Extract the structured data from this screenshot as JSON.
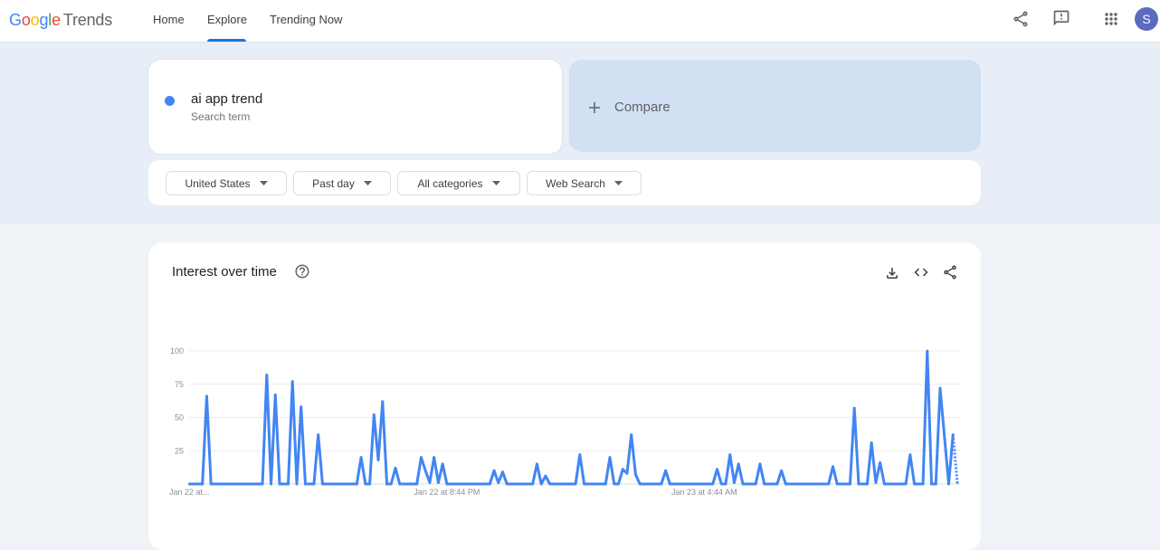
{
  "app": {
    "logo_word": "Google",
    "logo_colors": [
      "#4285f4",
      "#ea4335",
      "#fbbc05",
      "#4285f4",
      "#34a853",
      "#ea4335"
    ],
    "product_name": "Trends"
  },
  "nav": {
    "items": [
      {
        "label": "Home",
        "active": false
      },
      {
        "label": "Explore",
        "active": true
      },
      {
        "label": "Trending Now",
        "active": false
      }
    ],
    "accent_color": "#1a73e8"
  },
  "header_actions": {
    "icons": [
      "share-icon",
      "feedback-icon",
      "apps-grid-icon"
    ],
    "avatar": {
      "initial": "S",
      "color": "#5c6bc0"
    }
  },
  "search": {
    "term": "ai app trend",
    "sublabel": "Search term",
    "color": "#4285f4"
  },
  "compare": {
    "label": "Compare",
    "icon": "plus-icon"
  },
  "filters": [
    {
      "label": "United States"
    },
    {
      "label": "Past day"
    },
    {
      "label": "All categories"
    },
    {
      "label": "Web Search"
    }
  ],
  "interest_card": {
    "title": "Interest over time",
    "icons": [
      "help-icon",
      "download-icon",
      "embed-code-icon",
      "share-icon"
    ]
  },
  "chart_data": {
    "type": "line",
    "title": "Interest over time",
    "xlabel": "",
    "ylabel": "",
    "ylim": [
      0,
      100
    ],
    "yticks": [
      25,
      50,
      75,
      100
    ],
    "grid": true,
    "legend": "none",
    "interval_minutes": 8,
    "x_ticks": [
      {
        "index": 0,
        "label": "Jan 22 at..."
      },
      {
        "index": 60,
        "label": "Jan 22 at 8:44 PM"
      },
      {
        "index": 120,
        "label": "Jan 23 at 4:44 AM"
      }
    ],
    "partial_data_from_index": 178,
    "series": [
      {
        "name": "ai app trend",
        "color": "#4285f4",
        "values": [
          0,
          0,
          0,
          0,
          66,
          0,
          0,
          0,
          0,
          0,
          0,
          0,
          0,
          0,
          0,
          0,
          0,
          0,
          82,
          0,
          67,
          0,
          0,
          0,
          77,
          0,
          58,
          0,
          0,
          0,
          37,
          0,
          0,
          0,
          0,
          0,
          0,
          0,
          0,
          0,
          20,
          0,
          0,
          52,
          18,
          62,
          0,
          0,
          12,
          0,
          0,
          0,
          0,
          0,
          20,
          10,
          1,
          20,
          1,
          15,
          0,
          0,
          0,
          0,
          0,
          0,
          0,
          0,
          0,
          0,
          0,
          10,
          1,
          9,
          0,
          0,
          0,
          0,
          0,
          0,
          0,
          15,
          0,
          6,
          0,
          0,
          0,
          0,
          0,
          0,
          0,
          22,
          0,
          0,
          0,
          0,
          0,
          0,
          20,
          0,
          0,
          11,
          8,
          37,
          7,
          0,
          0,
          0,
          0,
          0,
          0,
          10,
          0,
          0,
          0,
          0,
          0,
          0,
          0,
          0,
          0,
          0,
          0,
          11,
          0,
          0,
          22,
          1,
          15,
          0,
          0,
          0,
          0,
          15,
          0,
          0,
          0,
          0,
          10,
          0,
          0,
          0,
          0,
          0,
          0,
          0,
          0,
          0,
          0,
          0,
          13,
          0,
          0,
          0,
          0,
          57,
          0,
          0,
          0,
          31,
          1,
          16,
          0,
          0,
          0,
          0,
          0,
          0,
          22,
          0,
          0,
          0,
          100,
          0,
          0,
          72,
          36,
          0,
          37,
          1
        ]
      }
    ]
  }
}
